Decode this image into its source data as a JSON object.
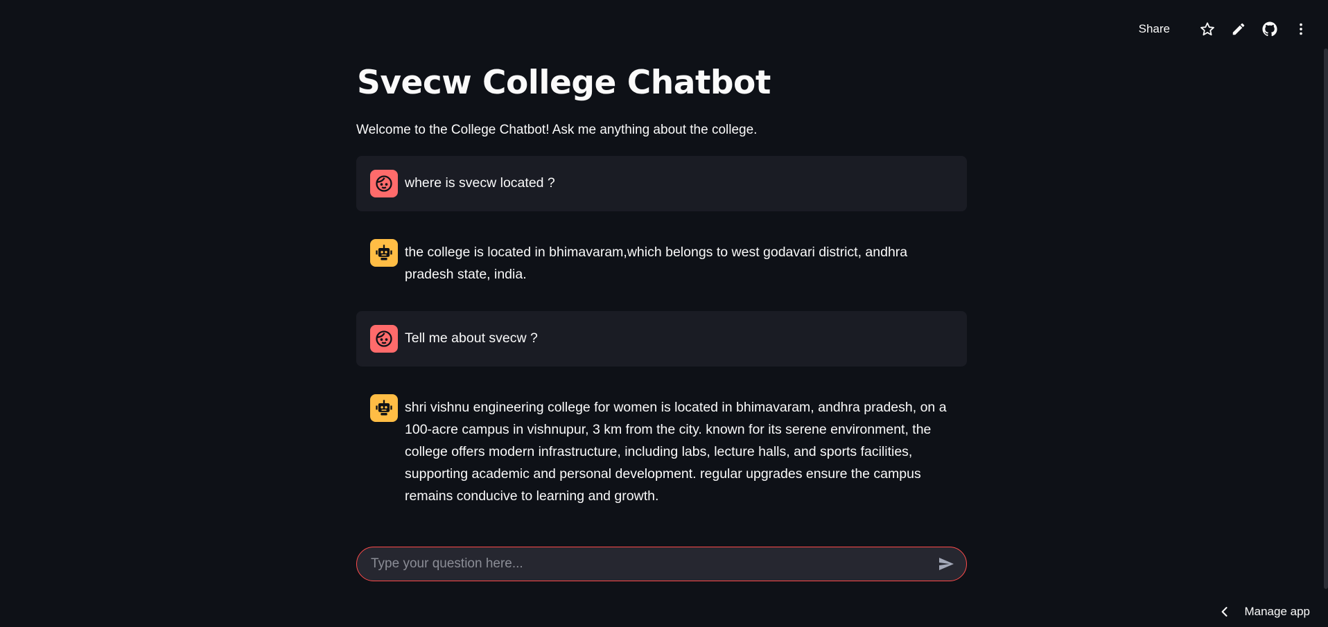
{
  "toolbar": {
    "share_label": "Share",
    "icons": [
      "star-icon",
      "pencil-icon",
      "github-icon",
      "kebab-menu-icon"
    ]
  },
  "page": {
    "title": "Svecw College Chatbot",
    "welcome": "Welcome to the College Chatbot! Ask me anything about the college."
  },
  "messages": [
    {
      "role": "user",
      "avatar_icon": "user-face-icon",
      "text": "where is svecw located ?"
    },
    {
      "role": "assistant",
      "avatar_icon": "robot-icon",
      "text": "the college is located in bhimavaram,which belongs to west godavari district, andhra pradesh state, india."
    },
    {
      "role": "user",
      "avatar_icon": "user-face-icon",
      "text": "Tell me about svecw ?"
    },
    {
      "role": "assistant",
      "avatar_icon": "robot-icon",
      "text": "shri vishnu engineering college for women is located in bhimavaram, andhra pradesh, on a 100-acre campus in vishnupur, 3 km from the city. known for its serene environment, the college offers modern infrastructure, including labs, lecture halls, and sports facilities, supporting academic and personal development. regular upgrades ensure the campus remains conducive to learning and growth."
    }
  ],
  "chat_input": {
    "placeholder": "Type your question here...",
    "value": "",
    "send_icon": "send-icon"
  },
  "footer": {
    "manage_label": "Manage app"
  },
  "colors": {
    "background": "#0e1117",
    "user_avatar": "#ff6b6b",
    "bot_avatar": "#ffbd45",
    "input_border": "#ff4b4b"
  }
}
